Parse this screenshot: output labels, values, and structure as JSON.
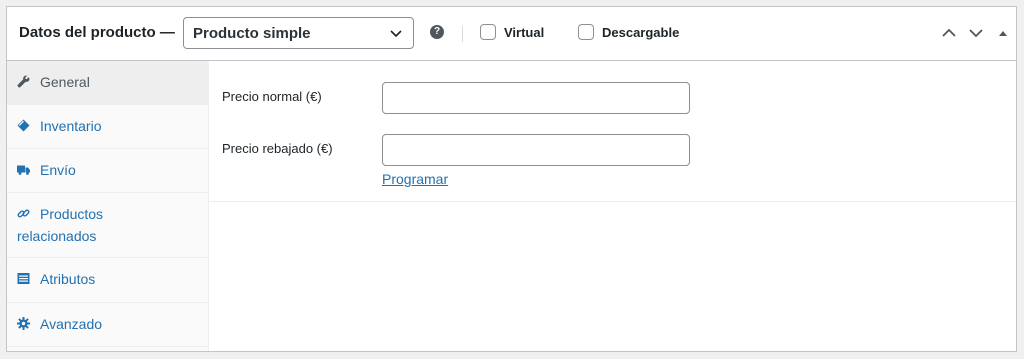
{
  "header": {
    "title": "Datos del producto —",
    "product_type": "Producto simple",
    "help_icon": "question-circle-icon",
    "virtual_label": "Virtual",
    "virtual_checked": false,
    "downloadable_label": "Descargable",
    "downloadable_checked": false,
    "controls": [
      "move-up-icon",
      "move-down-icon",
      "collapse-toggle-icon"
    ]
  },
  "tabs": [
    {
      "label": "General",
      "icon": "wrench-icon",
      "active": true
    },
    {
      "label": "Inventario",
      "icon": "tag-icon",
      "active": false
    },
    {
      "label": "Envío",
      "icon": "truck-icon",
      "active": false
    },
    {
      "label": "Productos relacionados",
      "icon": "link-icon",
      "active": false
    },
    {
      "label": "Atributos",
      "icon": "list-icon",
      "active": false
    },
    {
      "label": "Avanzado",
      "icon": "gear-icon",
      "active": false
    }
  ],
  "general": {
    "regular_price_label": "Precio normal (€)",
    "regular_price_value": "",
    "sale_price_label": "Precio rebajado (€)",
    "sale_price_value": "",
    "schedule_link": "Programar"
  },
  "colors": {
    "link": "#2271b1",
    "border": "#c3c4c7",
    "active_tab_bg": "#eeeeee"
  }
}
